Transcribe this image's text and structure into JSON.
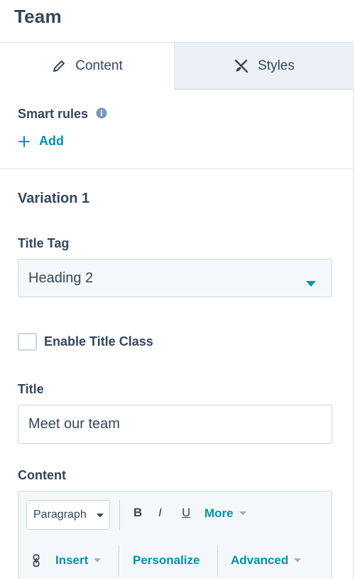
{
  "header": {
    "title": "Team"
  },
  "tabs": [
    {
      "label": "Content",
      "icon": "pencil-icon",
      "active": true
    },
    {
      "label": "Styles",
      "icon": "brush-icon",
      "active": false
    }
  ],
  "smart_rules": {
    "label": "Smart rules",
    "add_label": "Add"
  },
  "variation": {
    "title": "Variation 1"
  },
  "title_tag": {
    "label": "Title Tag",
    "value": "Heading 2"
  },
  "enable_title_class": {
    "label": "Enable Title Class",
    "checked": false
  },
  "title_field": {
    "label": "Title",
    "value": "Meet our team"
  },
  "content_field": {
    "label": "Content",
    "toolbar": {
      "paragraph": "Paragraph",
      "bold": "B",
      "italic": "I",
      "underline": "U",
      "more": "More",
      "insert": "Insert",
      "personalize": "Personalize",
      "advanced": "Advanced"
    }
  },
  "colors": {
    "text": "#33475b",
    "accent": "#0091ae",
    "border": "#cbd6e2",
    "tab_inactive_bg": "#eaf0f6"
  }
}
